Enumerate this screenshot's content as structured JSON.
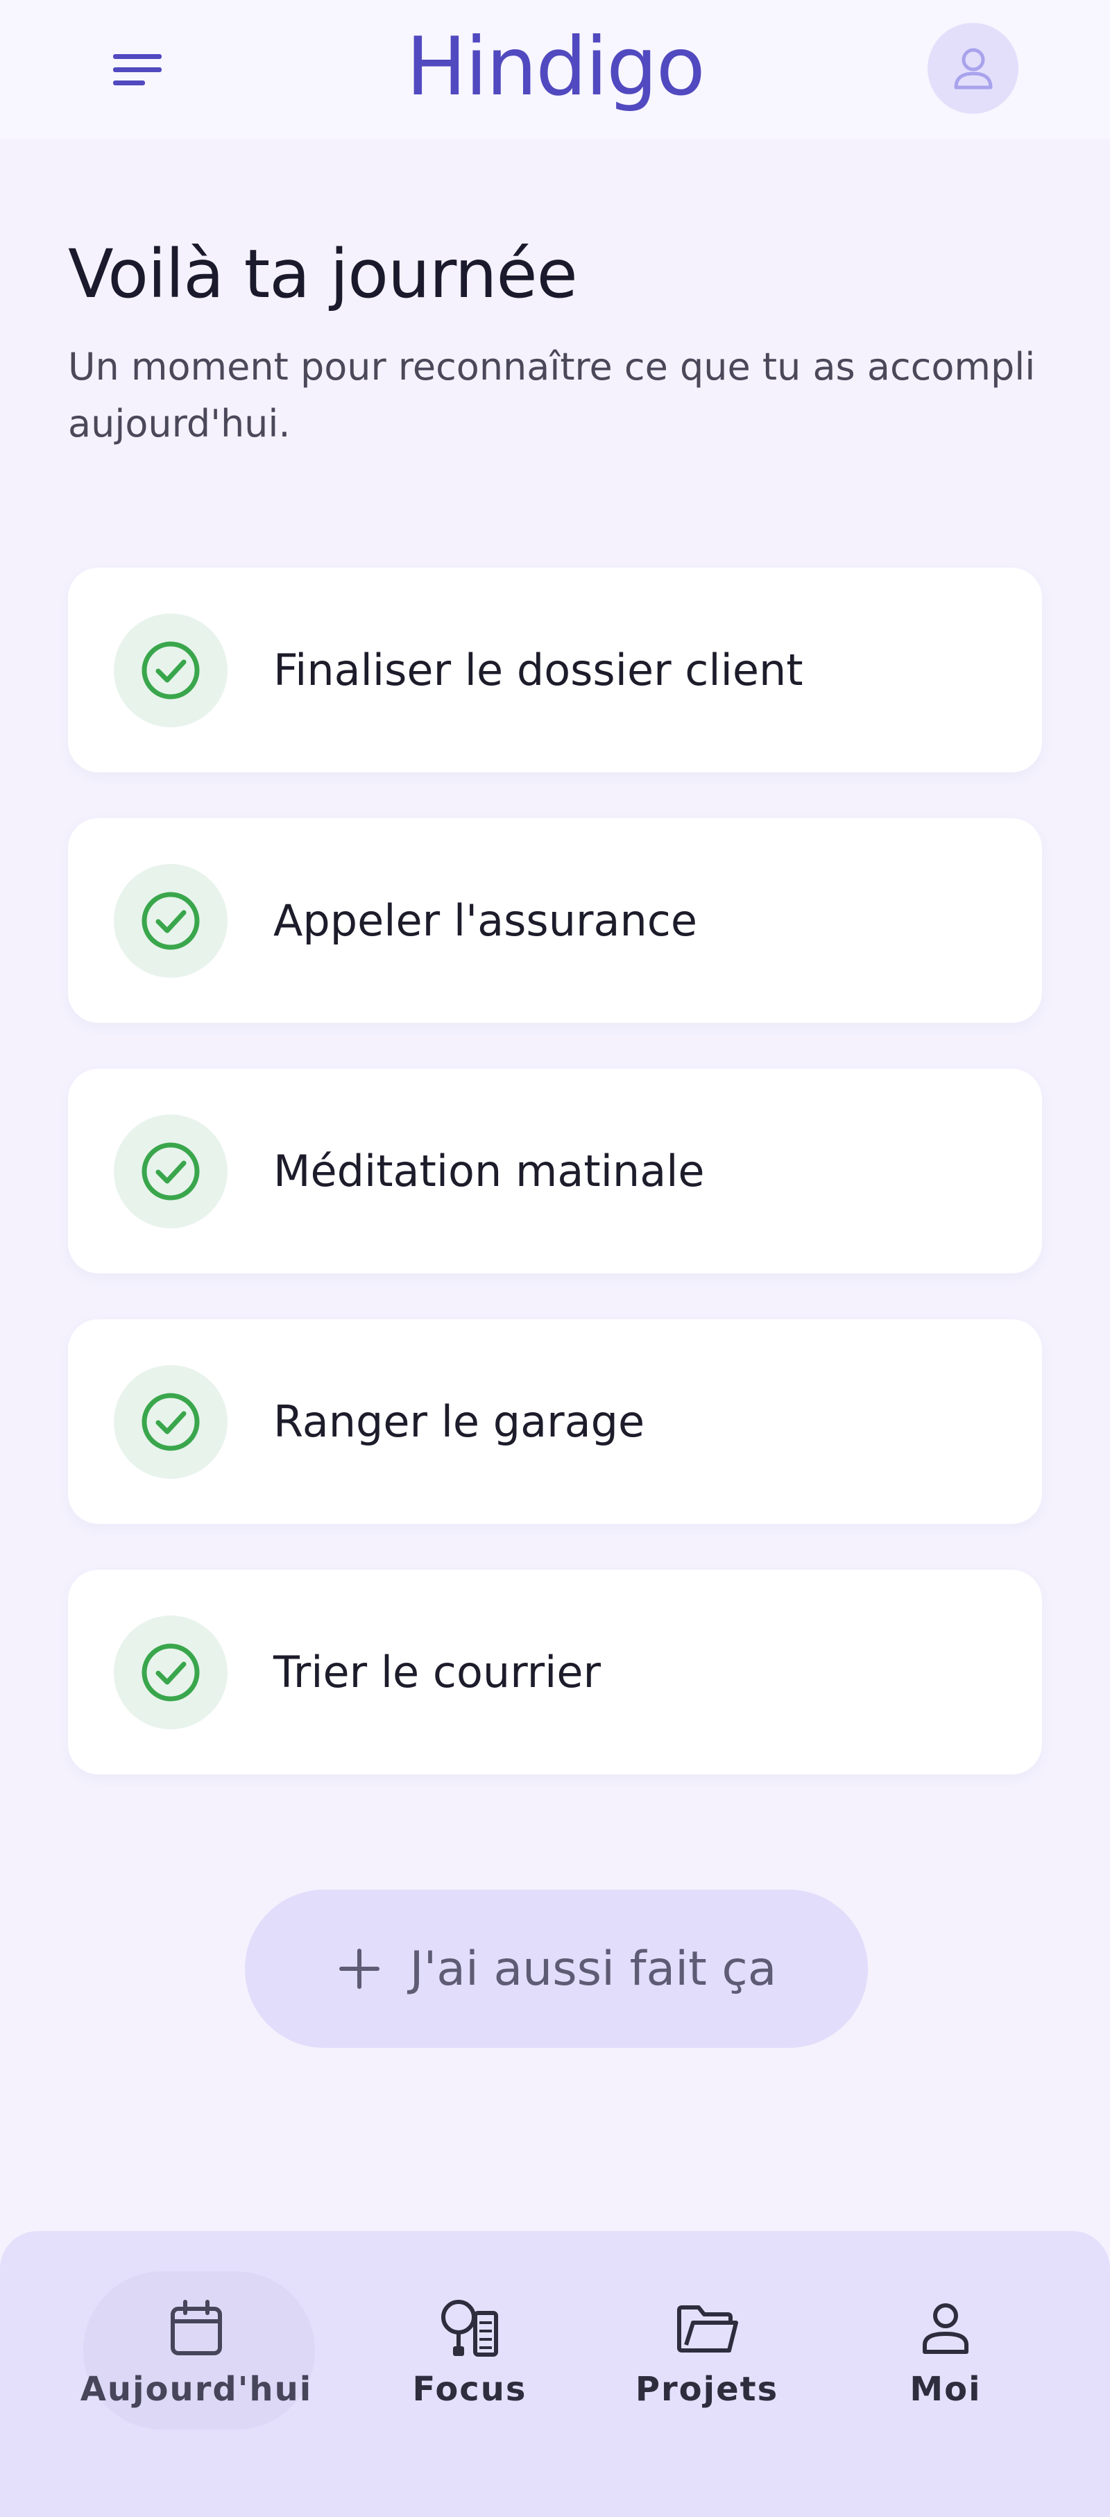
{
  "header": {
    "app_name": "Hindigo",
    "menu_icon": "menu-icon",
    "avatar_icon": "user-icon"
  },
  "page": {
    "title": "Voilà ta journée",
    "subtitle": "Un moment pour reconnaître ce que tu as accompli aujourd'hui."
  },
  "tasks": [
    {
      "label": "Finaliser le dossier client",
      "done": true
    },
    {
      "label": "Appeler l'assurance",
      "done": true
    },
    {
      "label": "Méditation matinale",
      "done": true
    },
    {
      "label": "Ranger le garage",
      "done": true
    },
    {
      "label": "Trier le courrier",
      "done": true
    }
  ],
  "add_button": {
    "label": "J'ai aussi fait ça",
    "icon": "plus-icon"
  },
  "bottom_nav": {
    "active": "Aujourd'hui",
    "items": [
      {
        "label": "Aujourd'hui",
        "icon": "calendar-icon"
      },
      {
        "label": "Focus",
        "icon": "focus-icon"
      },
      {
        "label": "Projets",
        "icon": "folder-icon"
      },
      {
        "label": "Moi",
        "icon": "person-icon"
      }
    ]
  },
  "colors": {
    "brand": "#5149bf",
    "background": "#f5f2fe",
    "check_green": "#3aa64c",
    "check_bg": "#e8f3ec",
    "button_bg": "#e1ddfa",
    "nav_bg": "#e4e0fb"
  }
}
